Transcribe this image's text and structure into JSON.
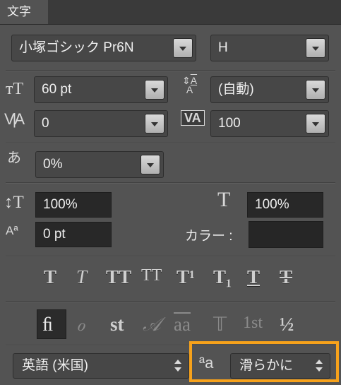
{
  "tab": {
    "label": "文字"
  },
  "font": {
    "family": "小塚ゴシック Pr6N",
    "style": "H"
  },
  "size": {
    "font_size": "60 pt",
    "leading": "(自動)"
  },
  "spacing": {
    "kerning": "0",
    "tracking": "100"
  },
  "tsume": {
    "value": "0%"
  },
  "scale": {
    "vertical": "100%",
    "horizontal": "100%"
  },
  "baseline": {
    "shift": "0 pt",
    "color_label": "カラー :",
    "color_value": "#262626"
  },
  "type_styles": [
    "T",
    "T",
    "TT",
    "TT",
    "T¹",
    "T₁",
    "T",
    "T"
  ],
  "opentype": [
    "ﬁ",
    "ℴ",
    "st",
    "𝒜",
    "aa",
    "𝕋",
    "1st",
    "½"
  ],
  "bottom": {
    "language": "英語 (米国)",
    "aa_icon": "ªa",
    "antialias": "滑らかに"
  },
  "highlight_color": "#f7a21b"
}
